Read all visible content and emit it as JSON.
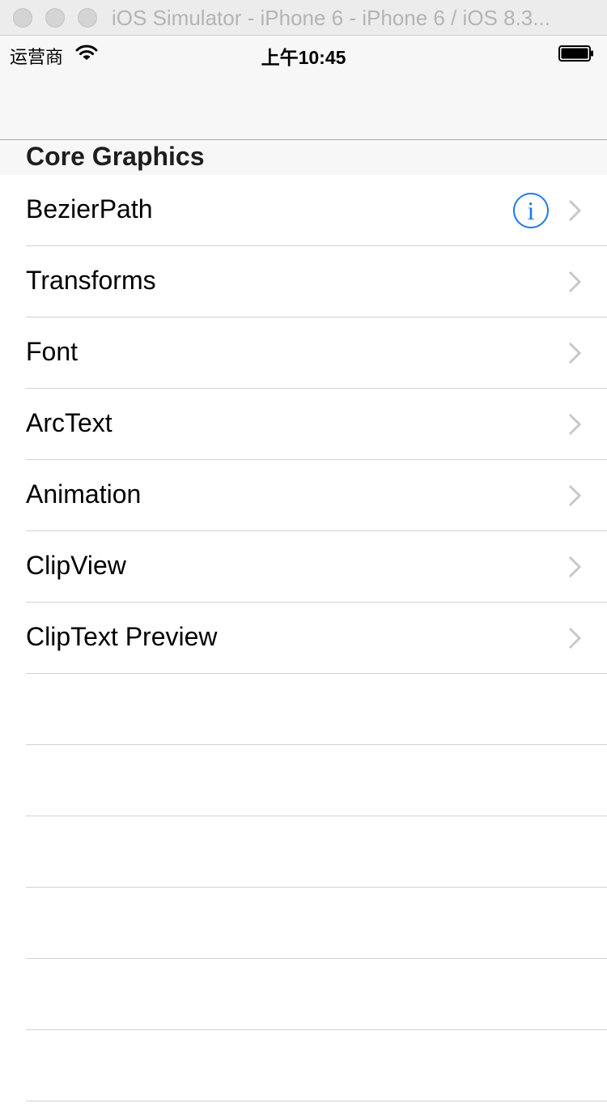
{
  "window": {
    "title": "iOS Simulator - iPhone 6 - iPhone 6 / iOS 8.3..."
  },
  "status_bar": {
    "carrier": "运营商",
    "time": "上午10:45"
  },
  "section": {
    "title": "Core Graphics"
  },
  "rows": [
    {
      "label": "BezierPath",
      "has_info": true
    },
    {
      "label": "Transforms"
    },
    {
      "label": "Font"
    },
    {
      "label": "ArcText"
    },
    {
      "label": "Animation"
    },
    {
      "label": "ClipView"
    },
    {
      "label": "ClipText Preview"
    }
  ],
  "empty_row_count": 6,
  "icons": {
    "info": "info-icon",
    "chevron": "chevron-right-icon",
    "wifi": "wifi-icon",
    "battery": "battery-icon"
  },
  "colors": {
    "accent": "#1a7bea",
    "chevron": "#c7c7cc",
    "separator": "#d2d2d2"
  }
}
